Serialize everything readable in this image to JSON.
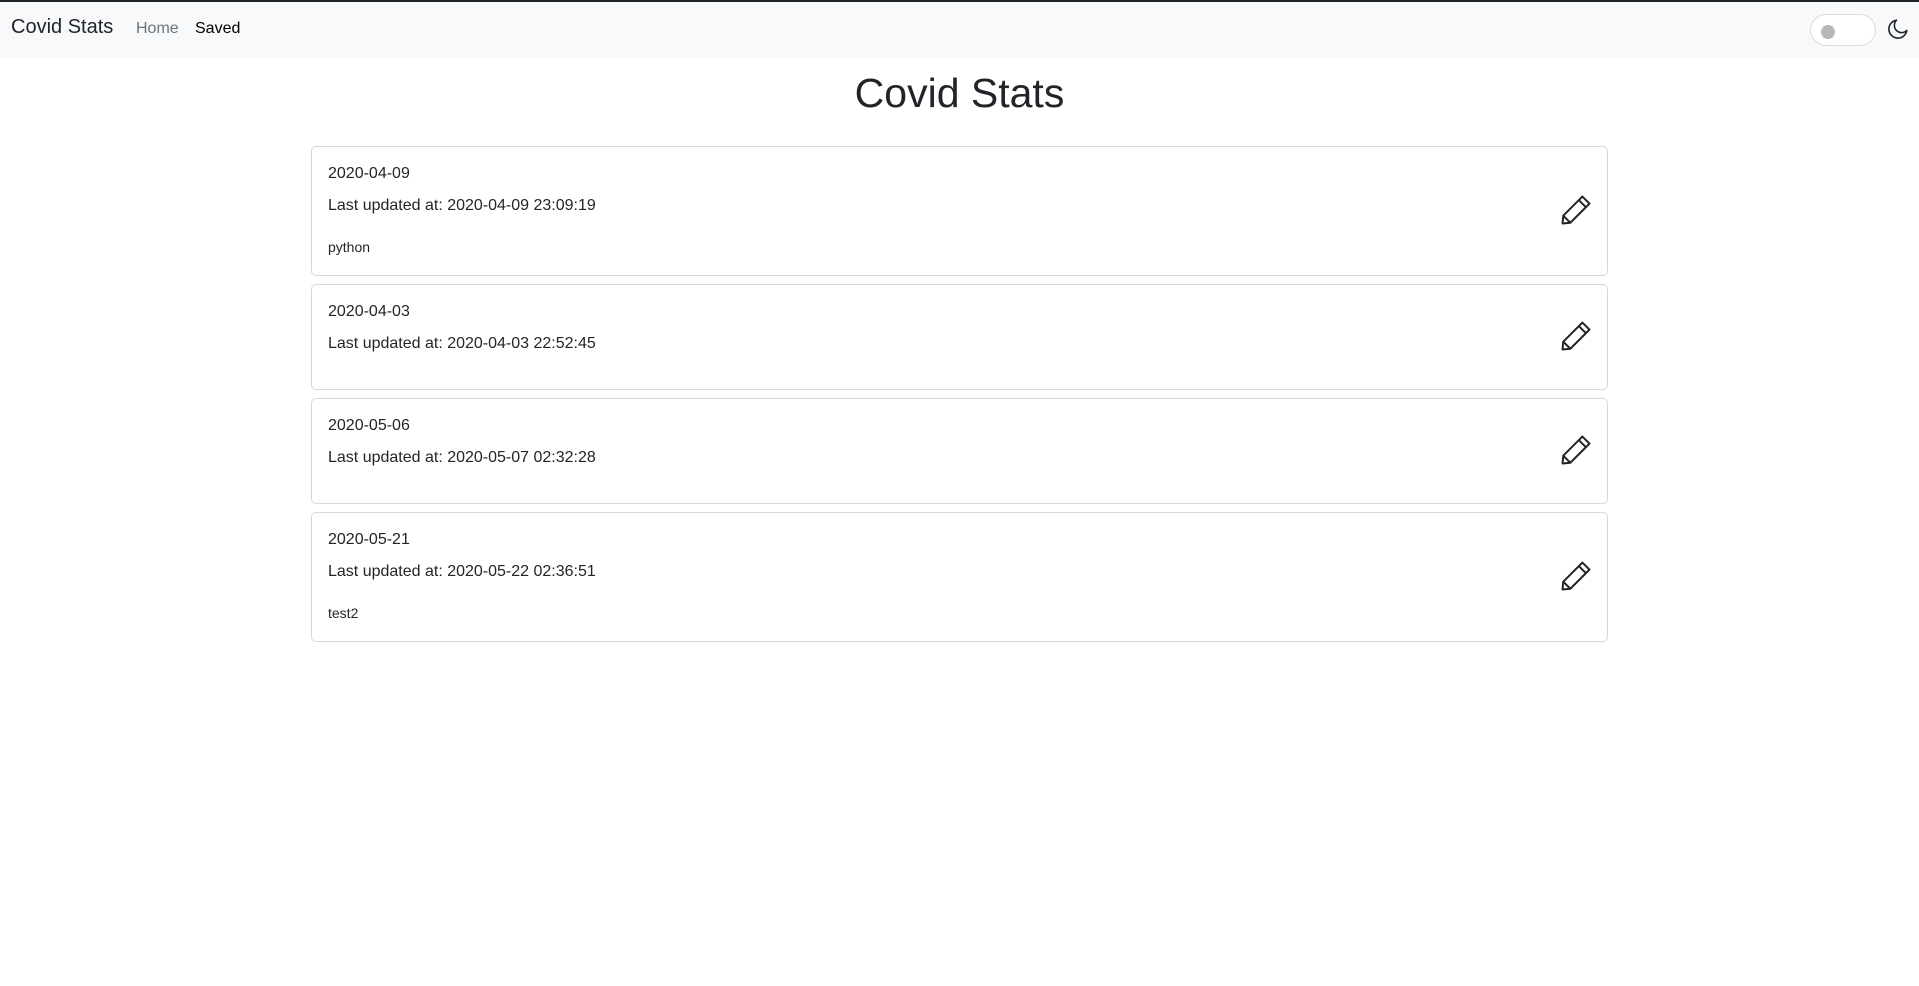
{
  "navbar": {
    "brand": "Covid Stats",
    "links": [
      {
        "label": "Home",
        "active": false
      },
      {
        "label": "Saved",
        "active": true
      }
    ],
    "theme_toggle_icon": "moon-icon"
  },
  "page": {
    "title": "Covid Stats"
  },
  "saved_items": [
    {
      "date": "2020-04-09",
      "updated": "Last updated at: 2020-04-09 23:09:19",
      "note": "python",
      "edit_icon": "pencil-icon"
    },
    {
      "date": "2020-04-03",
      "updated": "Last updated at: 2020-04-03 22:52:45",
      "note": "",
      "edit_icon": "pencil-icon"
    },
    {
      "date": "2020-05-06",
      "updated": "Last updated at: 2020-05-07 02:32:28",
      "note": "",
      "edit_icon": "pencil-icon"
    },
    {
      "date": "2020-05-21",
      "updated": "Last updated at: 2020-05-22 02:36:51",
      "note": "test2",
      "edit_icon": "pencil-icon"
    }
  ],
  "colors": {
    "navbar_bg": "#f8f9fa",
    "text": "#212529",
    "muted": "#6c757d",
    "card_border": "#d6d8db"
  }
}
